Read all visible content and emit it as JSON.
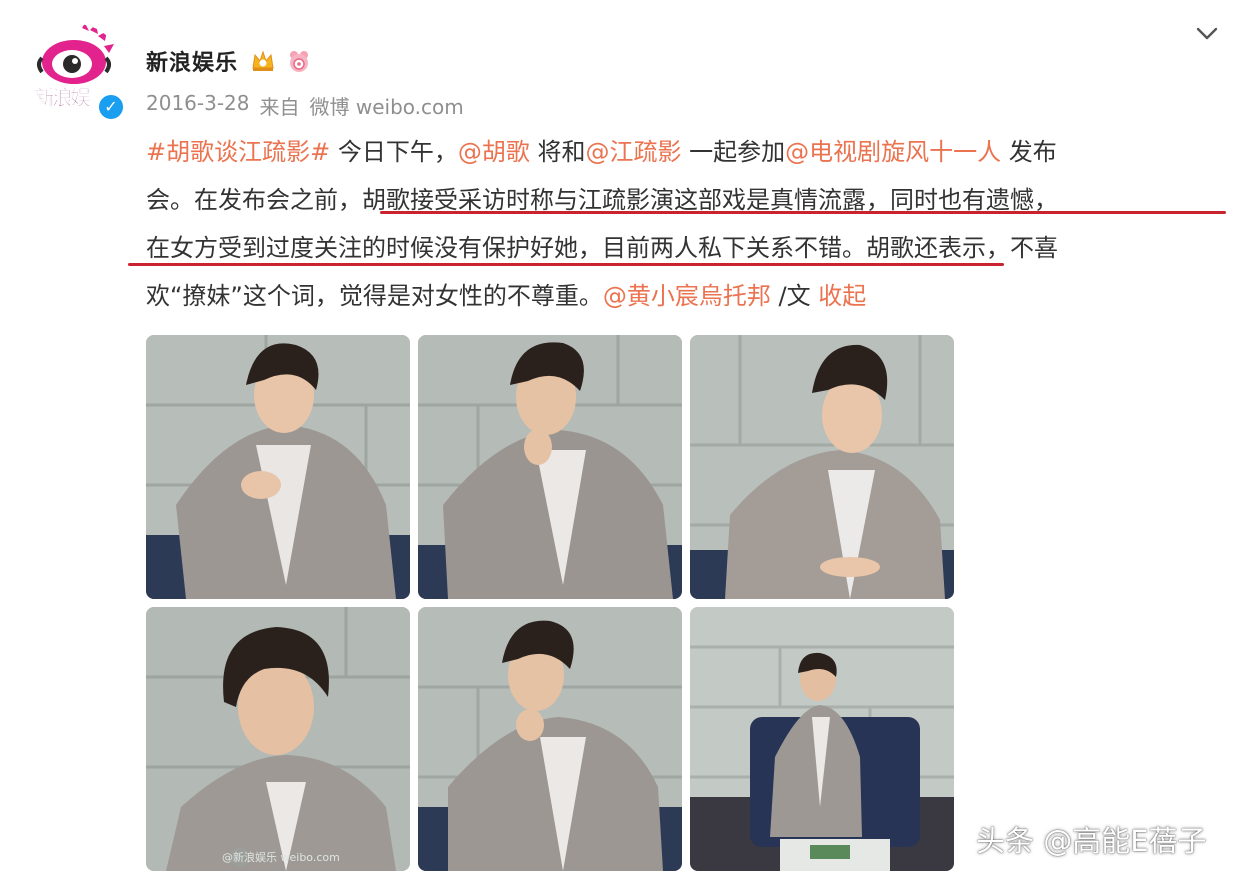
{
  "author": {
    "name": "新浪娱乐",
    "avatar_text": "新浪娱",
    "verified_icon": "verified-badge-icon",
    "badges": [
      "crown-icon",
      "member-icon"
    ]
  },
  "post": {
    "date": "2016-3-28",
    "source_prefix": "来自",
    "source": "微博 weibo.com",
    "lines": [
      [
        {
          "t": "#胡歌谈江疏影#",
          "link": true
        },
        {
          "t": " 今日下午，",
          "link": false
        },
        {
          "t": "@胡歌",
          "link": true
        },
        {
          "t": " 将和",
          "link": false
        },
        {
          "t": "@江疏影",
          "link": true
        },
        {
          "t": " 一起参加",
          "link": false
        },
        {
          "t": "@电视剧旋风十一人",
          "link": true
        },
        {
          "t": " 发布",
          "link": false
        }
      ],
      [
        {
          "t": "会。在发布会之前，胡歌接受采访时称与江疏影演这部戏是真情流露，同时也有遗憾，",
          "link": false
        }
      ],
      [
        {
          "t": "在女方受到过度关注的时候没有保护好她，目前两人私下关系不错。胡歌还表示，不喜",
          "link": false
        }
      ],
      [
        {
          "t": "欢“撩妹”这个词，觉得是对女性的不尊重。",
          "link": false
        },
        {
          "t": "@黄小宸烏托邦",
          "link": true
        },
        {
          "t": " /文 ",
          "link": false
        },
        {
          "t": "收起",
          "link": true
        }
      ]
    ]
  },
  "photos": [
    {
      "label": "photo-1"
    },
    {
      "label": "photo-2"
    },
    {
      "label": "photo-3"
    },
    {
      "label": "photo-4",
      "watermark": "@新浪娱乐  weibo.com"
    },
    {
      "label": "photo-5"
    },
    {
      "label": "photo-6"
    }
  ],
  "platform_watermark": "头条 @高能E蓓子",
  "colors": {
    "link": "#eb7350",
    "underline": "#c8232f",
    "meta": "#8f8f8f",
    "verified": "#1a9ef0"
  }
}
